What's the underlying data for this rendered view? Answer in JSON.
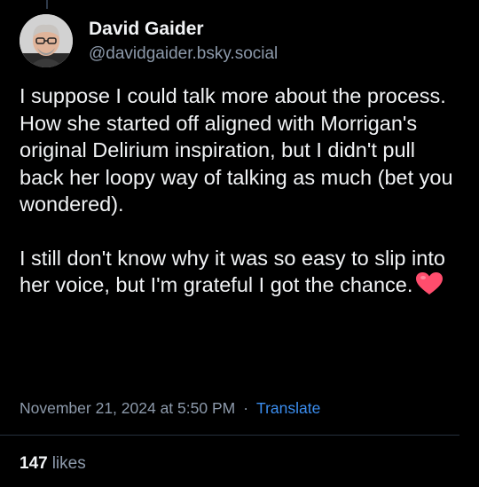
{
  "author": {
    "display_name": "David Gaider",
    "handle": "@davidgaider.bsky.social",
    "avatar_icon": "user-avatar"
  },
  "post": {
    "paragraphs": [
      "I suppose I could talk more about the process. How she started off aligned with Morrigan's original Delirium inspiration, but I didn't pull back her loopy way of talking as much (bet you wondered).",
      "I still don't know why it was so easy to slip into her voice, but I'm grateful I got the chance."
    ],
    "emoji": "heart-emoji"
  },
  "meta": {
    "timestamp": "November 21, 2024 at 5:50 PM",
    "separator": "·",
    "translate_label": "Translate"
  },
  "stats": {
    "likes_count": "147",
    "likes_label": "likes"
  },
  "colors": {
    "background": "#000000",
    "text": "#f1f3f5",
    "muted": "#8d9aab",
    "link": "#3b8ef0",
    "heart": "#ff4d6d"
  }
}
